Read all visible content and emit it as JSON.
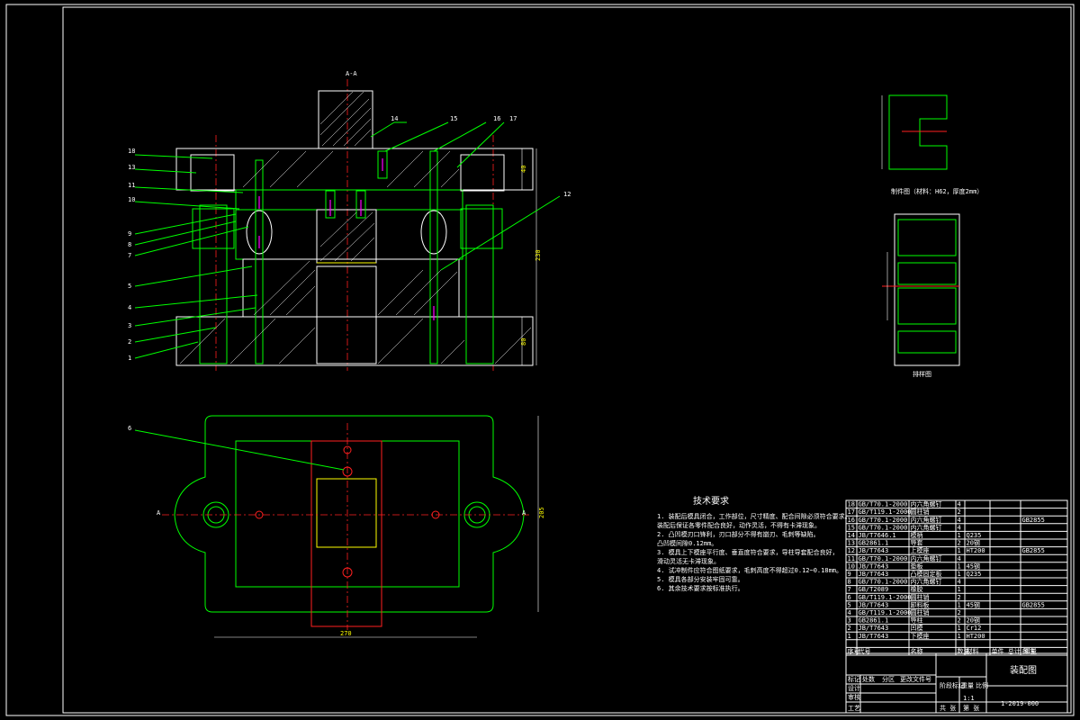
{
  "section_label": "A-A",
  "part_callouts": [
    "1",
    "2",
    "3",
    "4",
    "5",
    "7",
    "8",
    "9",
    "10",
    "11",
    "12",
    "13",
    "14",
    "15",
    "16",
    "17",
    "18"
  ],
  "plan_callout": "6",
  "plan_section_marks": [
    "A",
    "A"
  ],
  "dimensions": {
    "height_top": "40",
    "height_total": "230",
    "height_bottom": "80",
    "plan_width": "270",
    "plan_height": "205"
  },
  "part_caption": "制件图（材料：H62，厚度2mm）",
  "strip_caption": "排样图",
  "tech_title": "技术要求",
  "tech_notes": [
    "1. 装配后模具闭合，工作部位，尺寸精度、配合间隙必须符合要求。",
    "   装配后保证各零件配合良好，动作灵活，不得有卡滞现象。",
    "2. 凸凹模刃口锋利，刃口部分不得有崩刃、毛刺等缺陷。",
    "   凸凹模间隙0.12mm。",
    "3. 模具上下模座平行度、垂直度符合要求，导柱导套配合良好，",
    "   滑动灵活无卡滞现象。",
    "4. 试冲制件应符合图纸要求，毛刺高度不得超过0.12~0.18mm。",
    "5. 模具各部分安装牢固可靠。",
    "6. 其余技术要求按标准执行。"
  ],
  "bom_rows": [
    {
      "no": "18",
      "std": "GB/T70.1-2000",
      "name": "内六角螺钉",
      "qty": "4",
      "mat": "",
      "note": ""
    },
    {
      "no": "17",
      "std": "GB/T119.1-2000",
      "name": "圆柱销",
      "qty": "2",
      "mat": "",
      "note": ""
    },
    {
      "no": "16",
      "std": "GB/T70.1-2000",
      "name": "内六角螺钉",
      "qty": "4",
      "mat": "",
      "note": "GB2855"
    },
    {
      "no": "15",
      "std": "GB/T70.1-2000",
      "name": "内六角螺钉",
      "qty": "4",
      "mat": "",
      "note": ""
    },
    {
      "no": "14",
      "std": "JB/T7646.1",
      "name": "模柄",
      "qty": "1",
      "mat": "Q235",
      "note": ""
    },
    {
      "no": "13",
      "std": "GB2861.1",
      "name": "导套",
      "qty": "2",
      "mat": "20钢",
      "note": ""
    },
    {
      "no": "12",
      "std": "JB/T7643",
      "name": "上模座",
      "qty": "1",
      "mat": "HT200",
      "note": "GB2855"
    },
    {
      "no": "11",
      "std": "GB/T70.1-2000",
      "name": "内六角螺钉",
      "qty": "4",
      "mat": "",
      "note": ""
    },
    {
      "no": "10",
      "std": "JB/T7643",
      "name": "垫板",
      "qty": "1",
      "mat": "45钢",
      "note": ""
    },
    {
      "no": "9",
      "std": "JB/T7643",
      "name": "凸模固定板",
      "qty": "1",
      "mat": "Q235",
      "note": ""
    },
    {
      "no": "8",
      "std": "GB/T70.1-2000",
      "name": "内六角螺钉",
      "qty": "4",
      "mat": "",
      "note": ""
    },
    {
      "no": "7",
      "std": "GB/T2089",
      "name": "橡胶",
      "qty": "1",
      "mat": "",
      "note": ""
    },
    {
      "no": "6",
      "std": "GB/T119.1-2000",
      "name": "圆柱销",
      "qty": "2",
      "mat": "",
      "note": ""
    },
    {
      "no": "5",
      "std": "JB/T7643",
      "name": "卸料板",
      "qty": "1",
      "mat": "45钢",
      "note": "GB2855"
    },
    {
      "no": "4",
      "std": "GB/T119.1-2000",
      "name": "圆柱销",
      "qty": "2",
      "mat": "",
      "note": ""
    },
    {
      "no": "3",
      "std": "GB2861.1",
      "name": "导柱",
      "qty": "2",
      "mat": "20钢",
      "note": ""
    },
    {
      "no": "2",
      "std": "JB/T7643",
      "name": "凹模",
      "qty": "1",
      "mat": "Cr12",
      "note": ""
    },
    {
      "no": "1",
      "std": "JB/T7643",
      "name": "下模座",
      "qty": "1",
      "mat": "HT200",
      "note": ""
    }
  ],
  "bom_header": {
    "no": "序号",
    "std": "代号",
    "name": "名称",
    "qty": "数量",
    "mat": "材料",
    "weight": "单件 总计 重量",
    "note": "备注"
  },
  "title_block": {
    "drawing_title": "装配图",
    "drawing_no": "1-2019-000",
    "scale": "1:1",
    "labels": [
      "标记",
      "处数",
      "分区",
      "更改文件号",
      "签名",
      "年月日",
      "设计",
      "审核",
      "工艺",
      "标准化",
      "批准",
      "阶段标记",
      "重量",
      "比例",
      "共 张",
      "第 张"
    ]
  }
}
